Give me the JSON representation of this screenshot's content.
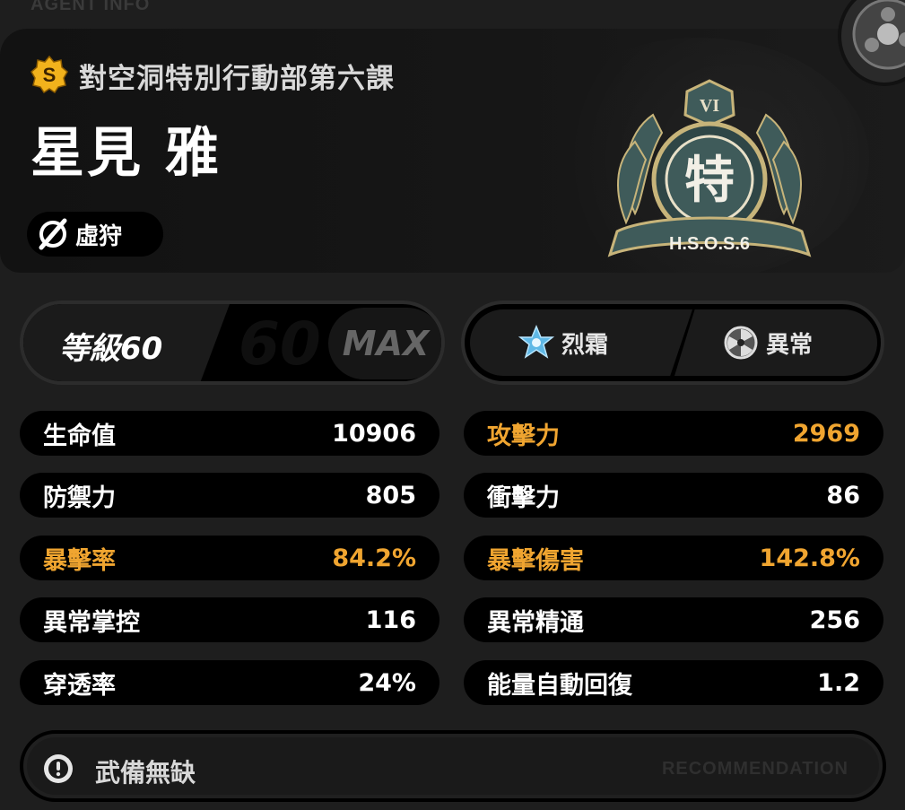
{
  "section_label": "AGENT INFO",
  "agent": {
    "rank": "S",
    "faction": "對空洞特別行動部第六課",
    "name": "星見 雅",
    "attribute": "虛狩",
    "emblem": {
      "roman": "VI",
      "char": "特",
      "ribbon": "H.S.O.S.6"
    }
  },
  "level": {
    "label": "等級60",
    "big": "60",
    "max": "MAX"
  },
  "specialties": [
    {
      "icon": "frost-crystal-icon",
      "label": "烈霜"
    },
    {
      "icon": "anomaly-icon",
      "label": "異常"
    }
  ],
  "stats_left": [
    {
      "key": "生命值",
      "value": "10906",
      "highlight": false
    },
    {
      "key": "防禦力",
      "value": "805",
      "highlight": false
    },
    {
      "key": "暴擊率",
      "value": "84.2%",
      "highlight": true
    },
    {
      "key": "異常掌控",
      "value": "116",
      "highlight": false
    },
    {
      "key": "穿透率",
      "value": "24%",
      "highlight": false
    }
  ],
  "stats_right": [
    {
      "key": "攻擊力",
      "value": "2969",
      "highlight": true
    },
    {
      "key": "衝擊力",
      "value": "86",
      "highlight": false
    },
    {
      "key": "暴擊傷害",
      "value": "142.8%",
      "highlight": true
    },
    {
      "key": "異常精通",
      "value": "256",
      "highlight": false
    },
    {
      "key": "能量自動回復",
      "value": "1.2",
      "highlight": false
    }
  ],
  "equipment": {
    "text": "武備無缺",
    "recommendation": "RECOMMENDATION"
  },
  "colors": {
    "highlight": "#f0a530",
    "emblem_teal": "#3f5b5a",
    "rank_gold": "#f2b21c"
  }
}
